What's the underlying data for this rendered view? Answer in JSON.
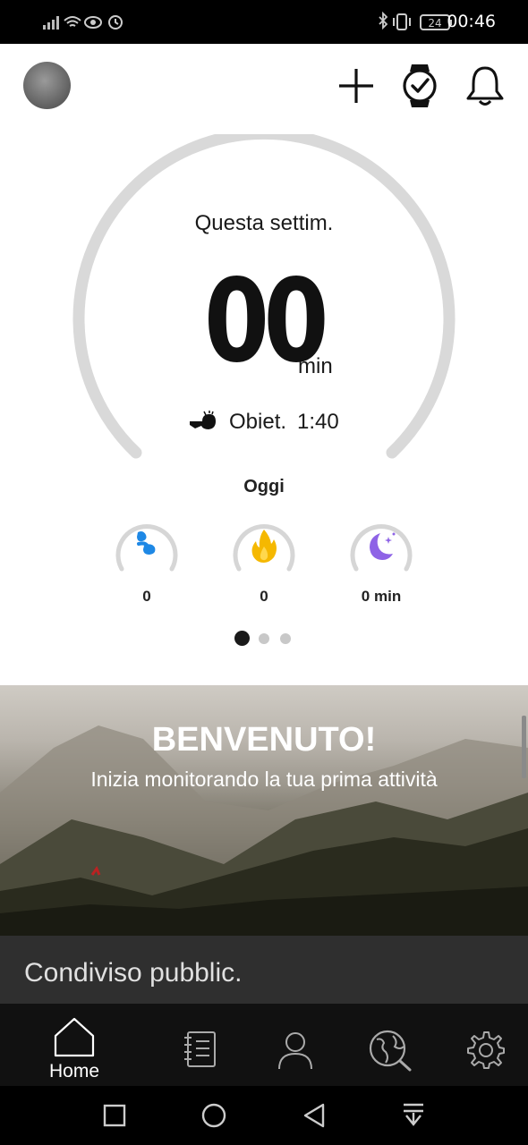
{
  "status_bar": {
    "time": "00:46",
    "battery": "24"
  },
  "header": {
    "icons": [
      "avatar",
      "plus-icon",
      "watch-check-icon",
      "bell-icon"
    ]
  },
  "weekly": {
    "title": "Questa settim.",
    "value": "00",
    "unit": "min",
    "goal_label": "Obiet.",
    "goal_value": "1:40",
    "progress": 0
  },
  "today": {
    "label": "Oggi",
    "stats": [
      {
        "icon": "steps-icon",
        "value": "0",
        "color": "#1e88e5"
      },
      {
        "icon": "flame-icon",
        "value": "0",
        "color": "#f5b800"
      },
      {
        "icon": "sleep-moon-icon",
        "value": "0 min",
        "color": "#8e63e6"
      }
    ]
  },
  "pager": {
    "pages": 3,
    "active": 1
  },
  "hero": {
    "title": "BENVENUTO!",
    "subtitle": "Inizia monitorando la tua prima attività"
  },
  "shared": {
    "label": "Condiviso pubblic."
  },
  "tabs": [
    {
      "name": "home",
      "label": "Home",
      "icon": "home-icon"
    },
    {
      "name": "diary",
      "label": "",
      "icon": "diary-icon"
    },
    {
      "name": "profile",
      "label": "",
      "icon": "person-icon"
    },
    {
      "name": "map",
      "label": "",
      "icon": "globe-search-icon"
    },
    {
      "name": "settings",
      "label": "",
      "icon": "gear-icon"
    }
  ],
  "colors": {
    "ring": "#d9d9d9",
    "tabbar": "#111111",
    "shared_bg": "#2f2f2f"
  }
}
